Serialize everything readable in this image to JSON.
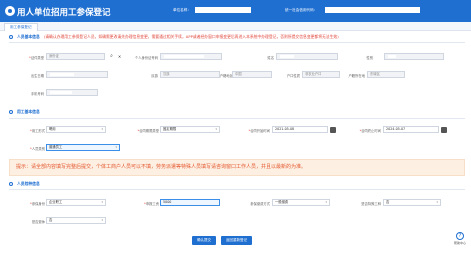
{
  "header": {
    "title": "用人单位招用工参保登记",
    "org_label": "单位名称：",
    "operator_label": "统一社会信用代码："
  },
  "tabs": [
    {
      "label": "用工参保登记"
    }
  ],
  "sections": {
    "basic": {
      "title": "人员基本信息",
      "note": "(请确认办理用工参保登记人员，如确需更改请先办理信息变更，需要通过相关手续，APP或者经办窗口申报变更后再进入本系统中办理登记，否则所提交信息变更都将无法生效)"
    },
    "employment": {
      "title": "用工基本信息"
    },
    "insurance": {
      "title": "人员险种信息"
    }
  },
  "basic": {
    "id_type_label": "证件类型",
    "id_type_value": "身份证",
    "id_number_label": "个人身份证号码",
    "name_label": "姓名",
    "gender_label": "性别",
    "birth_label": "出生日期",
    "nation_label": "民族",
    "nation_value": "汉族",
    "region_label": "户籍地区",
    "region_value": "中国",
    "reg_type_label": "户口性质",
    "reg_type_value": "非农业户口",
    "hukou_label": "户籍所在地",
    "hukou_value": "东城区",
    "phone_label": "手机号码"
  },
  "employment": {
    "emp_type_label": "用工形式",
    "emp_type_value": "聘用",
    "contract_type_label": "合同期限类型",
    "contract_type_value": "固定期限",
    "start_label": "合同开始时间",
    "start_value": "2021-05-08",
    "end_label": "合同终止时间",
    "end_value": "2024-05-07",
    "worker_type_label": "人员类别",
    "worker_type_value": "普通员工"
  },
  "notice": "提示：请全部内容填写完整后提交，个体工商户人员可以不填，劳务派遣等特殊人员填写请咨询窗口工作人员，并且以最新的为准。",
  "insurance": {
    "category_label": "参保身份",
    "category_value": "企业职工",
    "wage_label": "申报工资",
    "wage_value": "5000",
    "payment_label": "参保缴费方式",
    "payment_value": "一般缴费",
    "special_label": "是否特殊工种",
    "special_value": "否",
    "retired_label": "是否退休",
    "retired_value": "否"
  },
  "actions": {
    "submit_label": "确认提交",
    "back_label": "返回重新登记"
  },
  "help": {
    "label": "帮助中心"
  },
  "colors": {
    "primary": "#1f6fd1",
    "warning_bg": "#fdf0e3",
    "warning_text": "#e4572e",
    "required": "#e0463a"
  },
  "icons": {
    "search": "search-icon",
    "calendar": "calendar-icon",
    "dropdown": "chevron-down-icon",
    "help": "question-icon"
  }
}
